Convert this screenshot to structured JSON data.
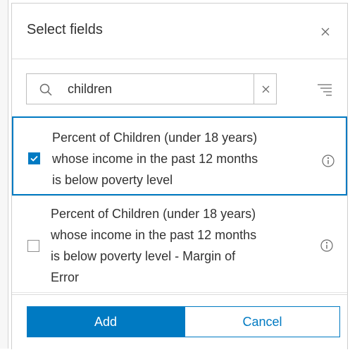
{
  "dialog": {
    "title": "Select fields",
    "close_icon": "close-icon"
  },
  "search": {
    "value": "children",
    "search_icon": "search-icon",
    "clear_icon": "clear-icon",
    "filter_icon": "filter-icon"
  },
  "fields": [
    {
      "label_lines": [
        "Percent of Children (under 18 years)",
        "whose income in the past 12 months",
        "is below poverty level"
      ],
      "checked": true,
      "info_icon": "info-icon"
    },
    {
      "label_lines": [
        "Percent of Children (under 18 years)",
        "whose income in the past 12 months",
        "is below poverty level - Margin of",
        "Error"
      ],
      "checked": false,
      "info_icon": "info-icon"
    }
  ],
  "footer": {
    "add_label": "Add",
    "cancel_label": "Cancel"
  },
  "colors": {
    "accent": "#007ac2",
    "text": "#323232",
    "border": "#bdbdbd"
  }
}
